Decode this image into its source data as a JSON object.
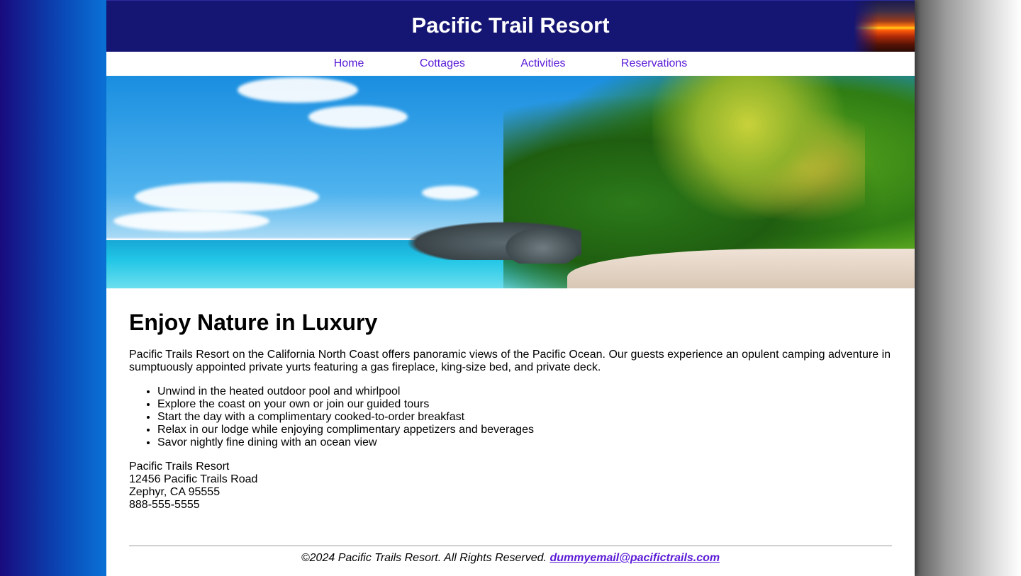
{
  "header": {
    "title": "Pacific Trail Resort"
  },
  "nav": {
    "items": [
      {
        "label": "Home"
      },
      {
        "label": "Cottages"
      },
      {
        "label": "Activities"
      },
      {
        "label": "Reservations"
      }
    ]
  },
  "main": {
    "heading": "Enjoy Nature in Luxury",
    "intro": "Pacific Trails Resort on the California North Coast offers panoramic views of the Pacific Ocean. Our guests experience an opulent camping adventure in sumptuously appointed private yurts featuring a gas fireplace, king-size bed, and private deck.",
    "features": [
      "Unwind in the heated outdoor pool and whirlpool",
      "Explore the coast on your own or join our guided tours",
      "Start the day with a complimentary cooked-to-order breakfast",
      "Relax in our lodge while enjoying complimentary appetizers and beverages",
      "Savor nightly fine dining with an ocean view"
    ],
    "address": {
      "name": "Pacific Trails Resort",
      "street": "12456 Pacific Trails Road",
      "city": "Zephyr, CA 95555",
      "phone": "888-555-5555"
    }
  },
  "footer": {
    "copyright": "©2024 Pacific Trails Resort. All Rights Reserved. ",
    "email": "dummyemail@pacifictrails.com"
  },
  "colors": {
    "header_bg": "#151573",
    "link": "#5a1ad6"
  }
}
